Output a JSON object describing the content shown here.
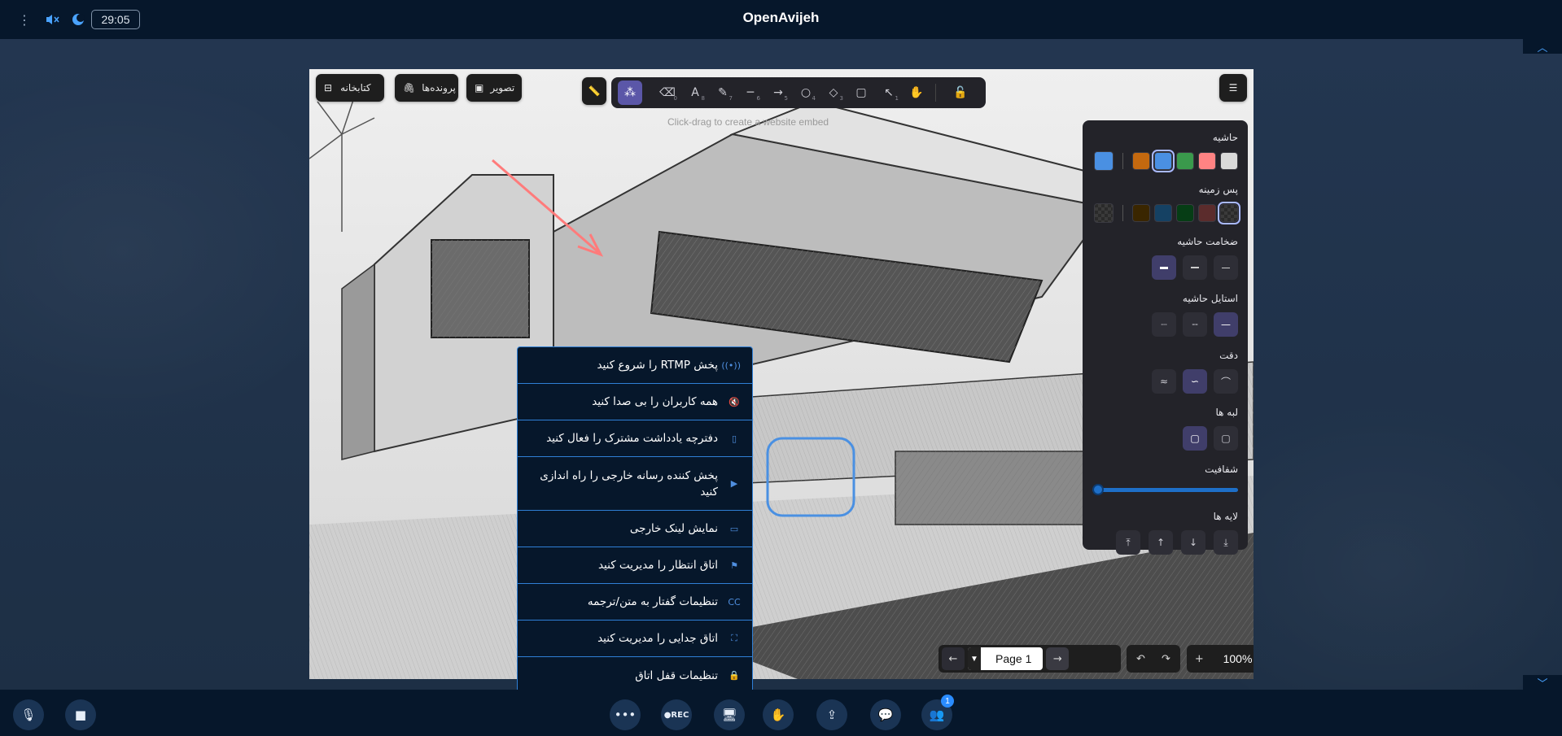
{
  "app": {
    "title": "OpenAvijeh",
    "timer": "29:05"
  },
  "board": {
    "top_buttons": {
      "library": "کتابخانه",
      "files": "پرونده‌ها",
      "image": "تصویر"
    },
    "hint": "Click-drag to create a website embed",
    "tool_shortcuts": [
      "0",
      "8",
      "7",
      "6",
      "5",
      "4",
      "3",
      "",
      "1"
    ],
    "panel": {
      "stroke": "حاشیه",
      "background": "پس زمینه",
      "stroke_width": "ضخامت حاشیه",
      "stroke_style": "استایل حاشیه",
      "sloppiness": "دقت",
      "edges": "لبه ها",
      "opacity": "شفافیت",
      "layers": "لایه ها",
      "stroke_colors": [
        "#d9d9d9",
        "#ff8383",
        "#3a994c",
        "#4a90e2",
        "#c4690f"
      ],
      "current_stroke": "#4a90e2",
      "bg_colors": [
        "#2e2e2e",
        "#5b2c2c",
        "#063d15",
        "#154163",
        "#3a2600"
      ],
      "opacity_value": 0
    },
    "page": {
      "label": "Page 1"
    },
    "zoom": {
      "value": "100%"
    }
  },
  "menu": {
    "items": [
      {
        "icon": "broadcast-icon",
        "glyph": "((•))",
        "label": "پخش RTMP را شروع کنید"
      },
      {
        "icon": "mute-all-icon",
        "glyph": "🔇",
        "label": "همه کاربران را بی صدا کنید"
      },
      {
        "icon": "notepad-icon",
        "glyph": "▯",
        "label": "دفترچه یادداشت مشترک را فعال کنید"
      },
      {
        "icon": "media-player-icon",
        "glyph": "▶",
        "label": "پخش کننده رسانه خارجی را راه اندازی کنید"
      },
      {
        "icon": "screen-link-icon",
        "glyph": "▭",
        "label": "نمایش لینک خارجی"
      },
      {
        "icon": "waiting-room-icon",
        "glyph": "⚑",
        "label": "اتاق انتظار را مدیریت کنید"
      },
      {
        "icon": "captions-icon",
        "glyph": "CC",
        "label": "تنظیمات گفتار به متن/ترجمه"
      },
      {
        "icon": "breakout-room-icon",
        "glyph": "⛶",
        "label": "اتاق جدایی را مدیریت کنید"
      },
      {
        "icon": "lock-icon",
        "glyph": "🔒",
        "label": "تنظیمات قفل اتاق"
      }
    ]
  },
  "bottombar": {
    "rec_label": "●REC",
    "participants_badge": "1"
  }
}
